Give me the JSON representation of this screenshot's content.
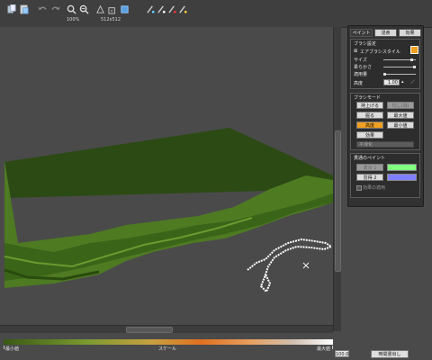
{
  "toolbar": {
    "zoom": "100%",
    "resolution": "512x512",
    "tools": [
      "copy-icon",
      "paste-icon",
      "undo-icon",
      "redo-icon",
      "zoom-in-icon",
      "zoom-out-icon",
      "fit-view-icon",
      "grid-icon",
      "resize-icon",
      "paint-icon",
      "brush-icon",
      "erase-icon",
      "picker-icon"
    ]
  },
  "panel": {
    "tabs": [
      "ペイント",
      "浸食",
      "効果"
    ],
    "brush": {
      "title": "ブラシ設定",
      "style_label": "エアブラシスタイル",
      "size_label": "サイズ",
      "softness_label": "柔らかさ",
      "amount_label": "適用量",
      "height_label": "高度",
      "height_value": "1.00"
    },
    "mode": {
      "title": "ブラシモード",
      "buttons": [
        {
          "label": "持上げる",
          "state": "normal"
        },
        {
          "label": "均し(滑)",
          "state": "disabled"
        },
        {
          "label": "掘る",
          "state": "normal"
        },
        {
          "label": "最大値",
          "state": "normal"
        },
        {
          "label": "高度",
          "state": "active"
        },
        {
          "label": "最小値",
          "state": "normal"
        },
        {
          "label": "効果",
          "state": "normal"
        }
      ],
      "select_value": "平滑化"
    },
    "mask": {
      "title": "貫通のペイント",
      "mask1_label": "表示 1",
      "mask2_label": "習得 2",
      "apply_label": "効果の適用",
      "color1": "#80ff80",
      "color2": "#8080ff"
    }
  },
  "scale": {
    "min_label": "最小値",
    "mid_label": "スケール",
    "max_label": "最大値",
    "value": "100.0",
    "export_label": "時間書出し"
  },
  "colors": {
    "terrain": "#2c4a14",
    "terrain_light": "#4e7a22",
    "background": "#4a4a4a",
    "accent": "#f0a020"
  }
}
